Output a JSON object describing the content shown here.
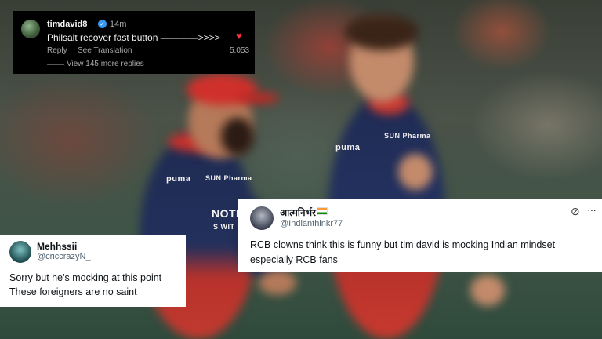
{
  "instagram_comment": {
    "username": "timdavid8",
    "time_ago": "14m",
    "comment": "Philsalt recover fast button ————>>>>",
    "reply_label": "Reply",
    "translation_label": "See Translation",
    "like_count": "5,053",
    "more_replies": "View 145 more replies",
    "icons": {
      "verified": "verified-badge-icon",
      "like": "heart-icon"
    },
    "colors": {
      "background": "#000000",
      "heart": "#ff3040",
      "verified": "#3897f0"
    }
  },
  "tweet_left": {
    "display_name": "Mehhssii",
    "handle": "@criccrazyN_",
    "text_line1": "Sorry but he's mocking at this point",
    "text_line2": "These foreigners are no saint"
  },
  "tweet_right": {
    "display_name": "आत्मनिर्भर",
    "handle": "@Indianthinkr77",
    "text_line1": "RCB clowns think this is funny but tim david is mocking Indian mindset",
    "text_line2": "especially RCB fans",
    "icons": {
      "flag": "india-flag-icon",
      "grok": "grok-icon",
      "more": "more-options-icon"
    }
  },
  "photo": {
    "jersey_text_left": "NOTE",
    "jersey_sub_left": "S WIT",
    "sponsor_left": "SUN Pharma",
    "sponsor_right": "SUN Pharma",
    "brand": "puma",
    "colors": {
      "jersey_navy": "#1f2b52",
      "jersey_red": "#c23a30",
      "cap_red": "#d0302b"
    }
  }
}
